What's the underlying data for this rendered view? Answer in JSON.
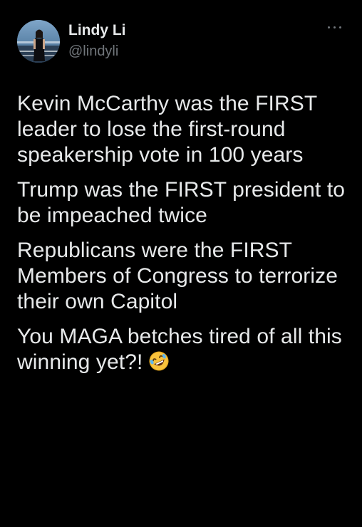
{
  "author": {
    "display_name": "Lindy Li",
    "handle": "@lindyli"
  },
  "menu": {
    "icon": "more-horizontal-icon"
  },
  "tweet": {
    "paragraphs": [
      "Kevin McCarthy was the FIRST leader to lose the first-round speakership vote in 100 years",
      "Trump was the FIRST president to be impeached twice",
      "Republicans were the FIRST Members of Congress to terrorize their own Capitol",
      "You MAGA betches tired of all this winning yet?!"
    ],
    "trailing_emoji": "rolling-on-the-floor-laughing-emoji"
  },
  "colors": {
    "background": "#000000",
    "text_primary": "#e7e9ea",
    "text_secondary": "#71767b"
  }
}
